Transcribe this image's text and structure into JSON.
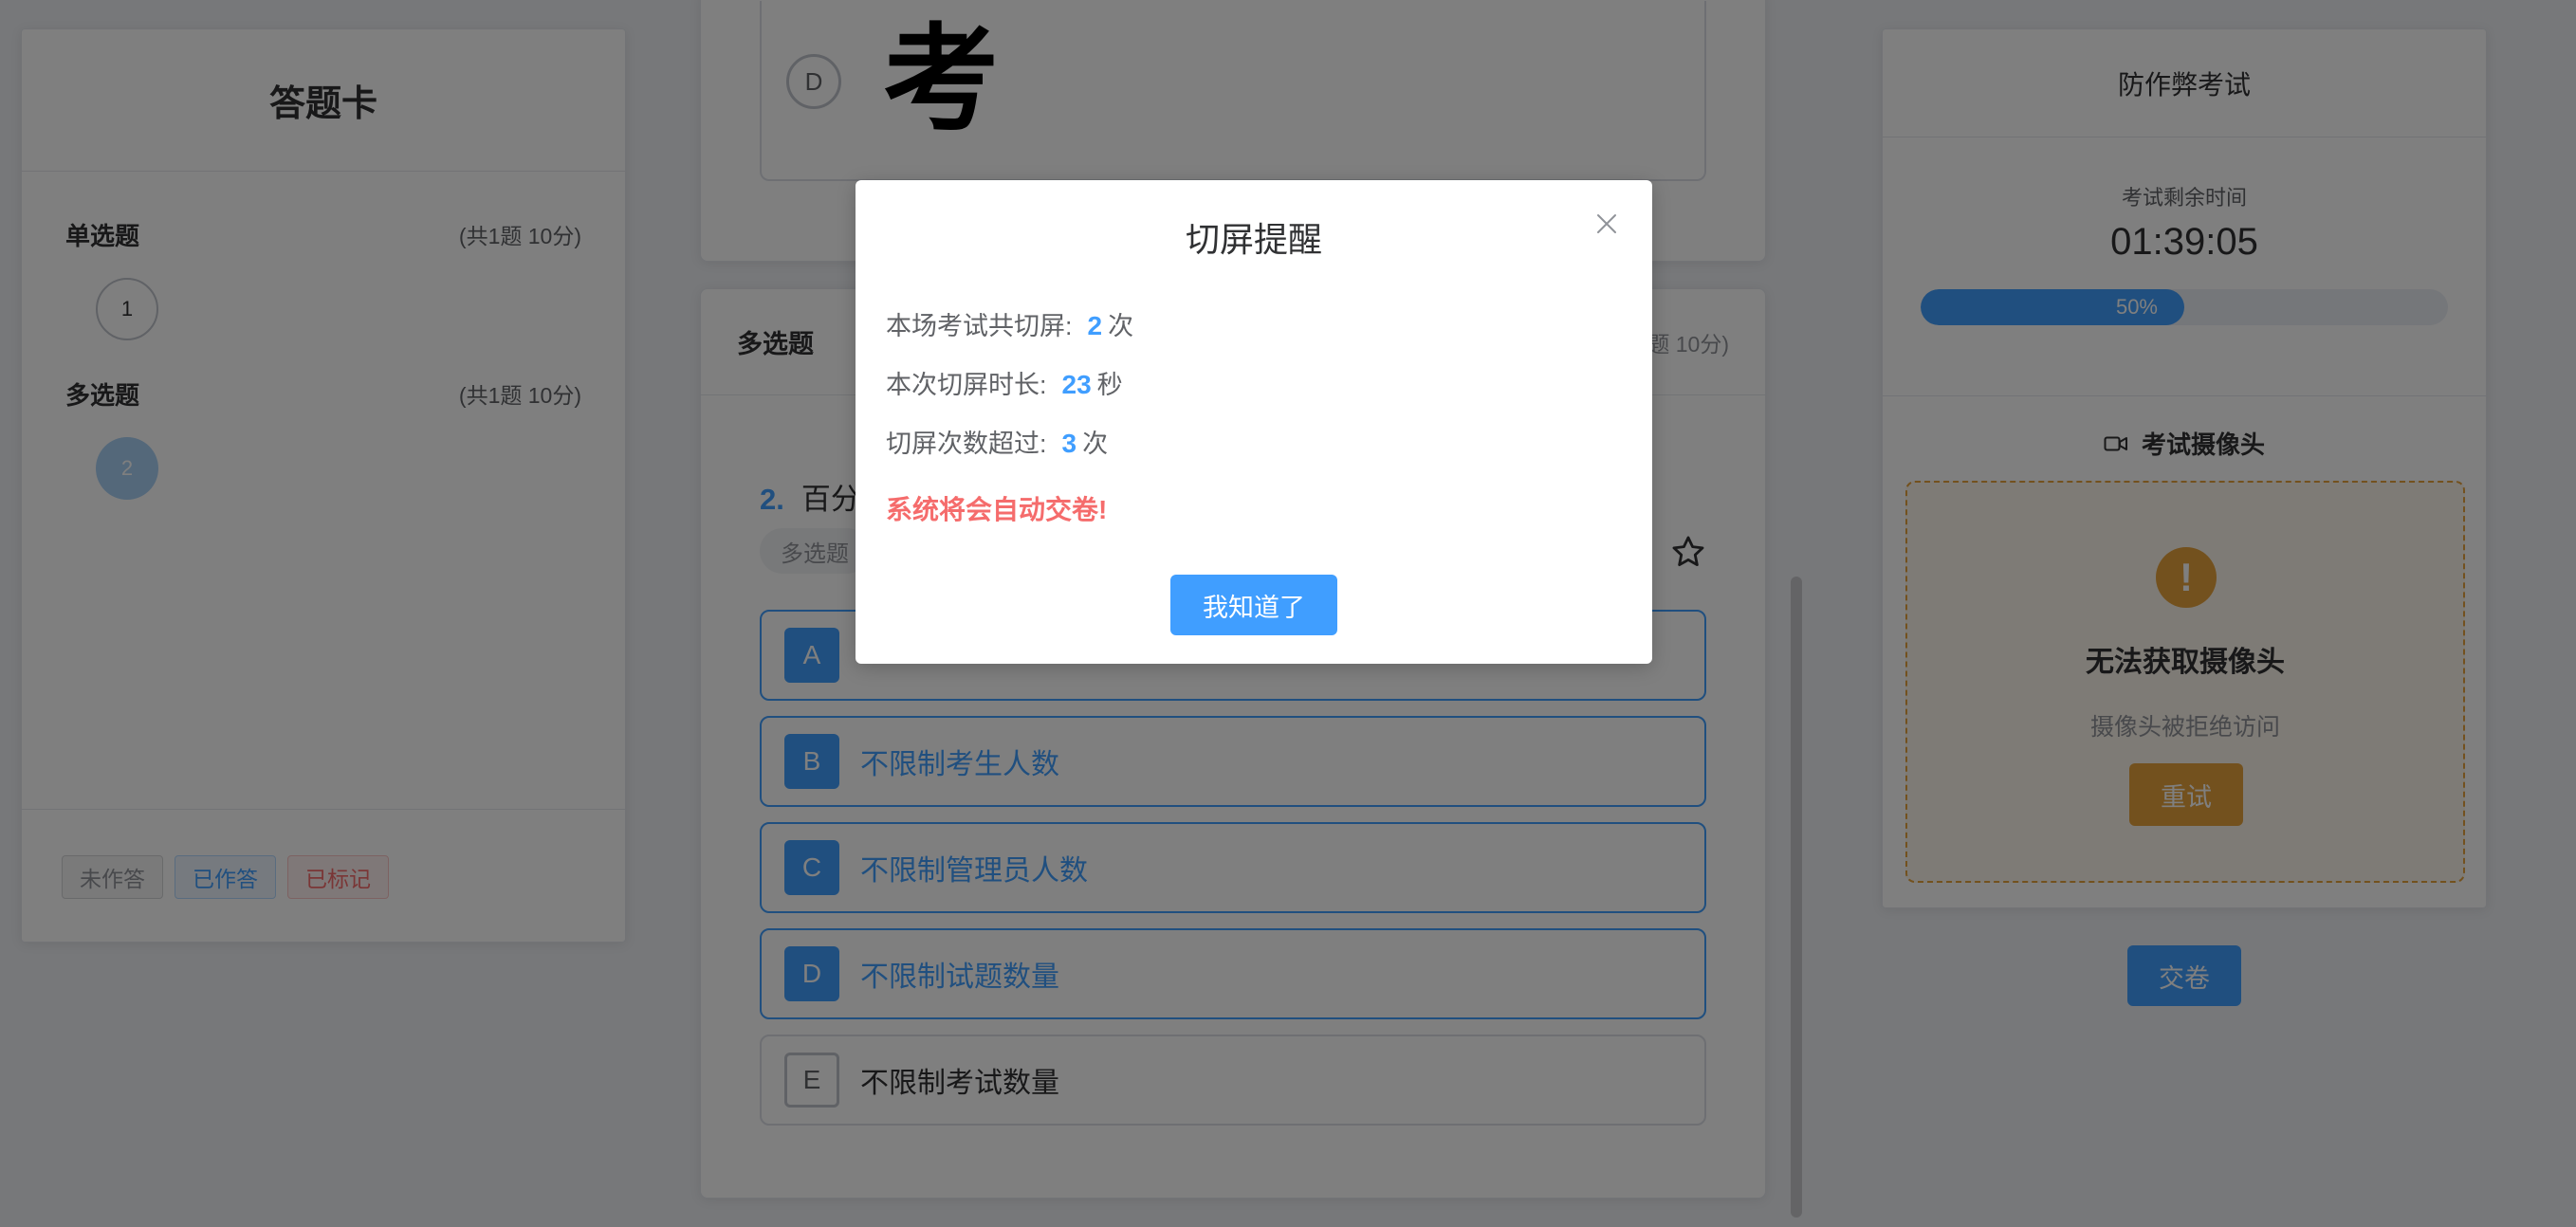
{
  "answer_card": {
    "title": "答题卡",
    "sections": [
      {
        "title": "单选题",
        "count": "(共1题 10分)",
        "questions": [
          "1"
        ]
      },
      {
        "title": "多选题",
        "count": "(共1题 10分)",
        "questions": [
          "2"
        ]
      }
    ],
    "legend": {
      "unanswered": "未作答",
      "answered": "已作答",
      "marked": "已标记"
    }
  },
  "previous_question": {
    "option_letter": "D",
    "option_text": "考"
  },
  "current_question": {
    "section_title": "多选题",
    "section_count_partial": "题 10分)",
    "number": "2.",
    "title_partial": "百分",
    "type_tag": "多选题",
    "options": [
      {
        "letter": "A",
        "text": "",
        "selected": true
      },
      {
        "letter": "B",
        "text": "不限制考生人数",
        "selected": true
      },
      {
        "letter": "C",
        "text": "不限制管理员人数",
        "selected": true
      },
      {
        "letter": "D",
        "text": "不限制试题数量",
        "selected": true
      },
      {
        "letter": "E",
        "text": "不限制考试数量",
        "selected": false
      }
    ],
    "star_icon": "star-outline-icon"
  },
  "anti_cheat": {
    "title": "防作弊考试",
    "timer_label": "考试剩余时间",
    "timer_value": "01:39:05",
    "progress_percent": 50,
    "progress_label": "50%",
    "camera_title": "考试摄像头",
    "camera_icon": "video-camera-icon",
    "camera_error_title": "无法获取摄像头",
    "camera_error_subtitle": "摄像头被拒绝访问",
    "retry_label": "重试",
    "submit_label": "交卷"
  },
  "modal": {
    "title": "切屏提醒",
    "row1_label": "本场考试共切屏:",
    "row1_value": "2",
    "row1_unit": "次",
    "row2_label": "本次切屏时长:",
    "row2_value": "23",
    "row2_unit": "秒",
    "row3_label": "切屏次数超过:",
    "row3_value": "3",
    "row3_unit": "次",
    "warning": "系统将会自动交卷!",
    "confirm_label": "我知道了"
  },
  "colors": {
    "primary": "#409eff",
    "warning": "#e6a23c",
    "danger": "#f56c6c",
    "overlay": "rgba(0,0,0,0.5)"
  }
}
